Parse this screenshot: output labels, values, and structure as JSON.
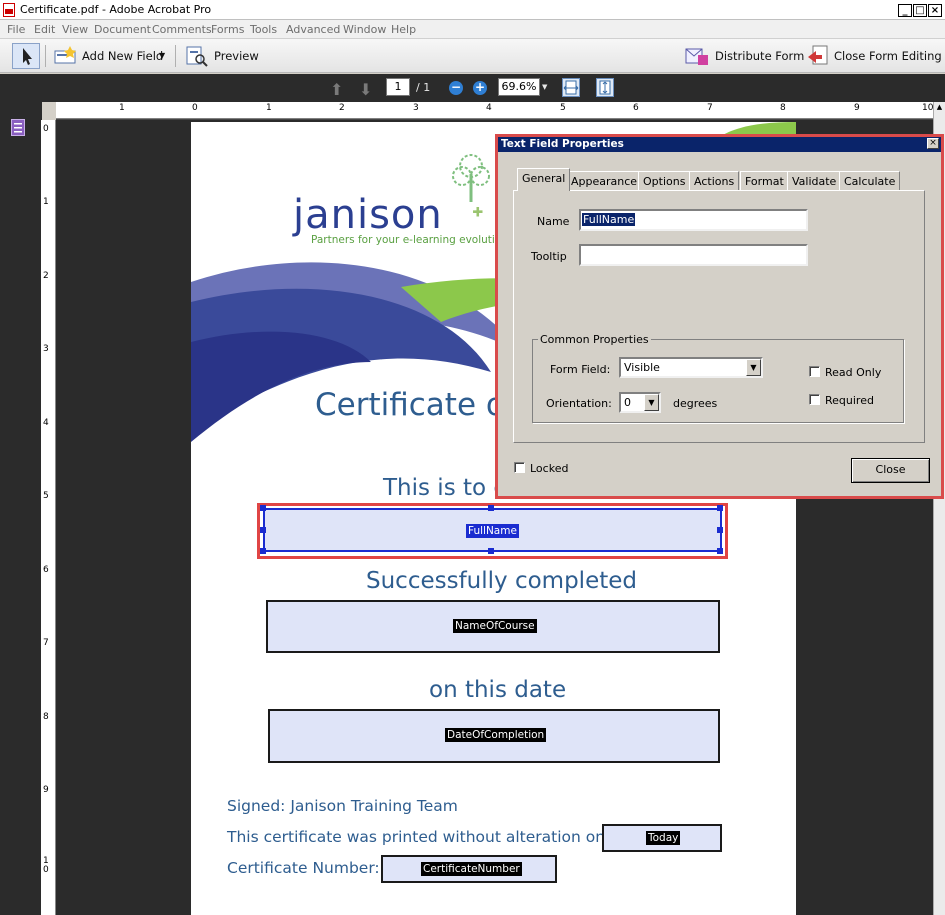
{
  "window": {
    "title": "Certificate.pdf - Adobe Acrobat Pro",
    "controls": [
      "_",
      "□",
      "×"
    ]
  },
  "menu": [
    "File",
    "Edit",
    "View",
    "Document",
    "Comments",
    "Forms",
    "Tools",
    "Advanced",
    "Window",
    "Help"
  ],
  "toolbar": {
    "add_new_field": "Add New Field",
    "preview": "Preview",
    "distribute_form": "Distribute Form",
    "close_form_editing": "Close Form Editing"
  },
  "nav": {
    "page_current": "1",
    "page_total": "/ 1",
    "zoom": "69.6%"
  },
  "rulers": {
    "horizontal": [
      "1",
      "0",
      "1",
      "2",
      "3",
      "4",
      "5",
      "6",
      "7",
      "8",
      "9",
      "10"
    ],
    "vertical": [
      "0",
      "1",
      "2",
      "3",
      "4",
      "5",
      "6",
      "7",
      "8",
      "9",
      "1\n0"
    ]
  },
  "certificate": {
    "logo_name": "janison",
    "logo_tagline": "Partners for your e-learning evolution",
    "heading": "Certificate of",
    "certify_line": "This is to c",
    "completed_line": "Successfully completed",
    "date_line": "on this date",
    "signed": "Signed: Janison Training Team",
    "printed_line": "This certificate was printed without alteration on:",
    "cert_number_label": "Certificate Number:",
    "fields": {
      "full_name": "FullName",
      "course": "NameOfCourse",
      "date": "DateOfCompletion",
      "today": "Today",
      "cert_number": "CertificateNumber"
    }
  },
  "dialog": {
    "title": "Text Field Properties",
    "tabs": [
      "General",
      "Appearance",
      "Options",
      "Actions",
      "Format",
      "Validate",
      "Calculate"
    ],
    "active_tab": "General",
    "name_label": "Name",
    "name_value": "FullName",
    "tooltip_label": "Tooltip",
    "tooltip_value": "",
    "common_properties": "Common Properties",
    "form_field_label": "Form Field:",
    "form_field_value": "Visible",
    "orientation_label": "Orientation:",
    "orientation_value": "0",
    "degrees_label": "degrees",
    "read_only_label": "Read Only",
    "required_label": "Required",
    "locked_label": "Locked",
    "close_button": "Close"
  },
  "colors": {
    "cert_blue": "#2e5d8f",
    "field_fill": "#dfe4f8",
    "highlight_red": "#d94b4b",
    "dialog_title": "#0a246a",
    "canvas_dark": "#2b2b2b"
  }
}
